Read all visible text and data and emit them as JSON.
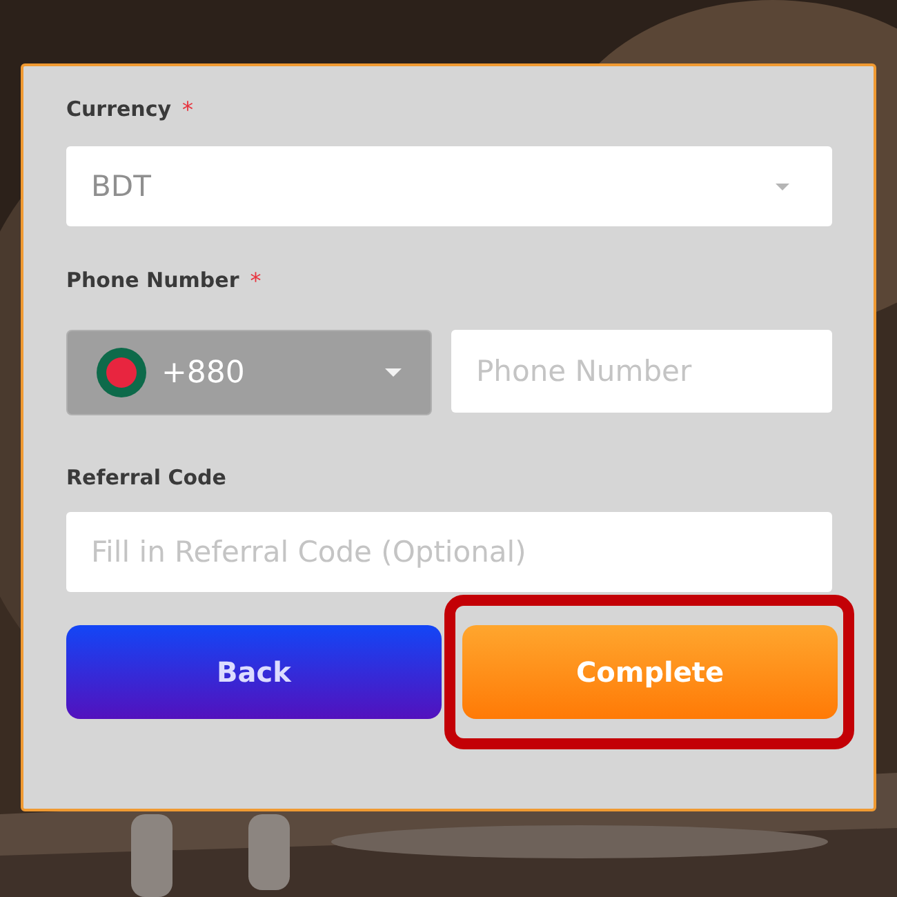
{
  "currency": {
    "label": "Currency",
    "required_mark": "*",
    "value": "BDT"
  },
  "phone": {
    "label": "Phone Number",
    "required_mark": "*",
    "country_code": "+880",
    "placeholder": "Phone Number"
  },
  "referral": {
    "label": "Referral Code",
    "placeholder": "Fill in Referral Code (Optional)"
  },
  "buttons": [
    {
      "label": "Back",
      "kind": "secondary",
      "highlighted": false
    },
    {
      "label": "Complete",
      "kind": "primary",
      "highlighted": true
    }
  ]
}
